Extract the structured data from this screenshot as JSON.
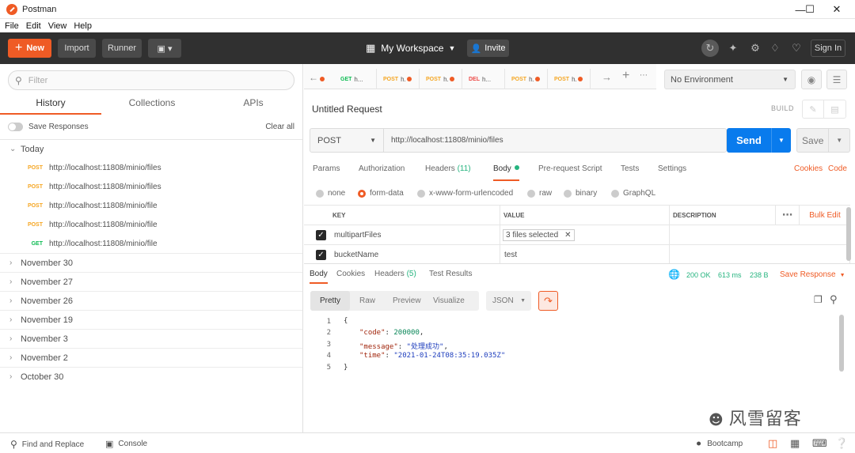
{
  "window": {
    "title": "Postman"
  },
  "menu": [
    "File",
    "Edit",
    "View",
    "Help"
  ],
  "header": {
    "new": "New",
    "import": "Import",
    "runner": "Runner",
    "workspace": "My Workspace",
    "invite": "Invite",
    "signin": "Sign In"
  },
  "sidebar": {
    "filter_placeholder": "Filter",
    "tabs": [
      "History",
      "Collections",
      "APIs"
    ],
    "save_responses": "Save Responses",
    "clear_all": "Clear all",
    "today": "Today",
    "requests": [
      {
        "method": "POST",
        "url": "http://localhost:11808/minio/files"
      },
      {
        "method": "POST",
        "url": "http://localhost:11808/minio/files"
      },
      {
        "method": "POST",
        "url": "http://localhost:11808/minio/file"
      },
      {
        "method": "POST",
        "url": "http://localhost:11808/minio/file"
      },
      {
        "method": "GET",
        "url": "http://localhost:11808/minio/file"
      }
    ],
    "groups": [
      "November 30",
      "November 27",
      "November 26",
      "November 19",
      "November 3",
      "November 2",
      "October 30"
    ]
  },
  "tabs": [
    {
      "method": "GET",
      "name": "h..."
    },
    {
      "method": "POST",
      "name": "h."
    },
    {
      "method": "POST",
      "name": "h."
    },
    {
      "method": "DEL",
      "name": "h..."
    },
    {
      "method": "POST",
      "name": "h."
    },
    {
      "method": "POST",
      "name": "h."
    }
  ],
  "environment": "No Environment",
  "request": {
    "name": "Untitled Request",
    "build": "BUILD",
    "method": "POST",
    "url": "http://localhost:11808/minio/files",
    "send": "Send",
    "save": "Save",
    "tabs": [
      "Params",
      "Authorization",
      "Headers",
      "(11)",
      "Body",
      "Pre-request Script",
      "Tests",
      "Settings"
    ],
    "cookies": "Cookies",
    "code": "Code",
    "body_types": [
      "none",
      "form-data",
      "x-www-form-urlencoded",
      "raw",
      "binary",
      "GraphQL"
    ],
    "table_headers": [
      "KEY",
      "VALUE",
      "DESCRIPTION",
      "Bulk Edit"
    ],
    "rows": [
      {
        "key": "multipartFiles",
        "value": "3 files selected"
      },
      {
        "key": "bucketName",
        "value": "test"
      }
    ]
  },
  "response": {
    "tabs": [
      "Body",
      "Cookies",
      "Headers",
      "(5)",
      "Test Results"
    ],
    "status": "200 OK",
    "time": "613 ms",
    "size": "238 B",
    "save_response": "Save Response",
    "formats": [
      "Pretty",
      "Raw",
      "Preview",
      "Visualize"
    ],
    "lang": "JSON",
    "lines": [
      "1",
      "2",
      "3",
      "4",
      "5"
    ],
    "json": {
      "code_key": "\"code\"",
      "code_val": "200000",
      "msg_key": "\"message\"",
      "msg_val": "\"处理成功\"",
      "time_key": "\"time\"",
      "time_val": "\"2021-01-24T08:35:19.035Z\""
    }
  },
  "bottom": {
    "find": "Find and Replace",
    "console": "Console",
    "bootcamp": "Bootcamp"
  },
  "watermark": "风雪留客"
}
